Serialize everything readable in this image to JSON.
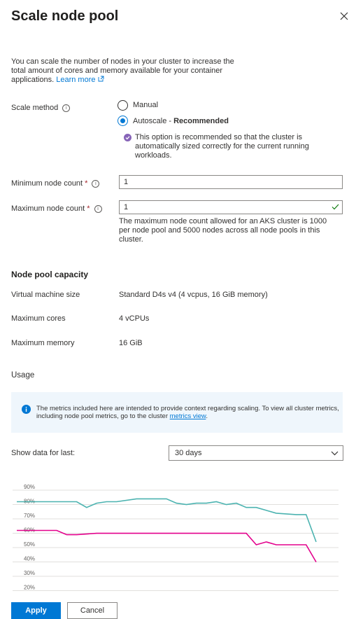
{
  "panel": {
    "title": "Scale node pool",
    "close_icon": "close-icon"
  },
  "intro": {
    "text": "You can scale the number of nodes in your cluster to increase the total amount of cores and memory available for your container applications.",
    "link": "Learn more",
    "link_icon": "external-link-icon"
  },
  "scale_method": {
    "label": "Scale method",
    "options": [
      {
        "label": "Manual",
        "selected": false
      },
      {
        "label": "Autoscale",
        "suffix": "Recommended",
        "selected": true
      }
    ],
    "recommendation_icon": "check-circle-icon",
    "recommendation": "This option is recommended so that the cluster is automatically sized correctly for the current running workloads."
  },
  "min_count": {
    "label": "Minimum node count",
    "required": "*",
    "value": "1"
  },
  "max_count": {
    "label": "Maximum node count",
    "required": "*",
    "value": "1",
    "help": "The maximum node count allowed for an AKS cluster is 1000 per node pool and 5000 nodes across all node pools in this cluster."
  },
  "capacity": {
    "title": "Node pool capacity",
    "rows": [
      {
        "label": "Virtual machine size",
        "value": "Standard D4s v4 (4 vcpus, 16 GiB memory)"
      },
      {
        "label": "Maximum cores",
        "value": "4 vCPUs"
      },
      {
        "label": "Maximum memory",
        "value": "16 GiB"
      }
    ]
  },
  "usage": {
    "title": "Usage",
    "banner_icon": "info-icon",
    "banner_text": "The metrics included here are intended to provide context regarding scaling. To view all cluster metrics, including node pool metrics, go to the cluster",
    "banner_link": "metrics view",
    "banner_end": ".",
    "show_data_label": "Show data for last:",
    "show_data_value": "30 days"
  },
  "chart_data": {
    "type": "line",
    "ylim": [
      20,
      90
    ],
    "y_ticks": [
      "90%",
      "80%",
      "70%",
      "60%",
      "50%",
      "40%",
      "30%",
      "20%"
    ],
    "grid": true,
    "series": [
      {
        "color": "#4bb3b0",
        "x": [
          0,
          2,
          4,
          6,
          7,
          8,
          9,
          10,
          12,
          14,
          15,
          16,
          17,
          18,
          19,
          20,
          21,
          22,
          23,
          24,
          26,
          28,
          29,
          30
        ],
        "y": [
          80,
          80,
          80,
          80,
          76,
          79,
          80,
          80,
          82,
          82,
          82,
          79,
          78,
          79,
          79,
          80,
          78,
          79,
          76,
          76,
          72,
          71,
          71,
          52
        ]
      },
      {
        "color": "#e3008c",
        "x": [
          0,
          2,
          4,
          5,
          6,
          8,
          10,
          12,
          14,
          16,
          18,
          20,
          22,
          23,
          24,
          25,
          26,
          28,
          29,
          30
        ],
        "y": [
          60,
          60,
          60,
          57,
          57,
          58,
          58,
          58,
          58,
          58,
          58,
          58,
          58,
          58,
          50,
          52,
          50,
          50,
          50,
          38
        ]
      }
    ]
  },
  "footer": {
    "apply": "Apply",
    "cancel": "Cancel"
  }
}
